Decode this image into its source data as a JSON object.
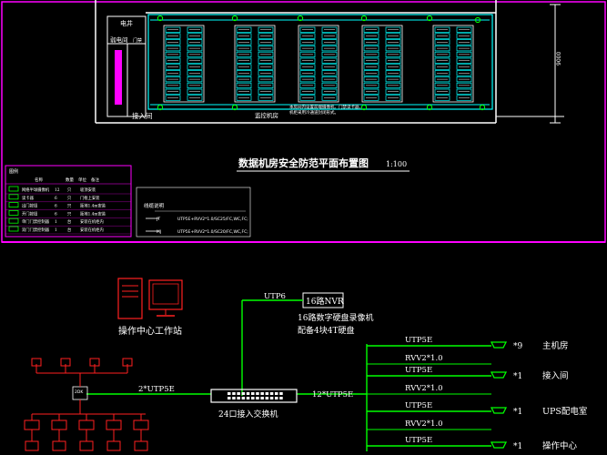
{
  "floorplan": {
    "title": "数据机房安全防范平面布置图",
    "scale": "1:100",
    "rooms": {
      "power": "电井",
      "security_room": "弱电间",
      "access_room": "接入间",
      "monitor_room": "监控机房",
      "side_label": "门禁",
      "dimension": "9000"
    },
    "notes": [
      "本房间内设置前端摄像机、门禁读卡器，",
      "机柜采用冷通道封闭形式。"
    ],
    "legend": {
      "headers": [
        "图例",
        "名称",
        "数量",
        "单位",
        "备注"
      ],
      "rows": [
        [
          "网络半球摄像机",
          "12",
          "只",
          "吸顶安装"
        ],
        [
          "读卡器",
          "6",
          "只",
          "门框上安装"
        ],
        [
          "出门按钮",
          "6",
          "只",
          "距地1.4m安装"
        ],
        [
          "开门按钮",
          "6",
          "只",
          "距地1.4m安装"
        ],
        [
          "单门门禁控制器",
          "1",
          "台",
          "安装在机柜内"
        ],
        [
          "双门门禁控制器",
          "1",
          "台",
          "安装在机柜内"
        ]
      ]
    },
    "cable_title": "线缆说明",
    "cables": [
      {
        "code": "JT",
        "desc": "UTP5E+RVV2*1.0/SC25/FC,WC,FC;"
      },
      {
        "code": "MJ",
        "desc": "UTP5E+RVV2*1.0/SC20/FC,WC,FC;"
      }
    ],
    "colors": {
      "frame": "#ff00ff",
      "rack": "#00ffff",
      "wall": "#ffffff",
      "legend_border": "#ff00ff"
    }
  },
  "system": {
    "workstation_label": "操作中心工作站",
    "nvr_box": "16路NVR",
    "nvr_line1": "16路数字硬盘录像机",
    "nvr_line2": "配备4块4T硬盘",
    "link_nvr": "UTP6",
    "link_left": "2*UTP5E",
    "link_right": "12*UTP5E",
    "switch_label": "24口接入交换机",
    "small_switch_label": "2DK",
    "branches": [
      {
        "cable_a": "UTP5E",
        "cable_b": "RVV2*1.0",
        "count": "*9",
        "location": "主机房"
      },
      {
        "cable_a": "UTP5E",
        "cable_b": "RVV2*1.0",
        "count": "*1",
        "location": "接入间"
      },
      {
        "cable_a": "UTP5E",
        "cable_b": "RVV2*1.0",
        "count": "*1",
        "location": "UPS配电室"
      },
      {
        "cable_a": "UTP5E",
        "cable_b": "",
        "count": "*1",
        "location": "操作中心"
      }
    ],
    "colors": {
      "line": "#00ff00",
      "device_red": "#ff2020",
      "camera": "#00ff00"
    }
  }
}
